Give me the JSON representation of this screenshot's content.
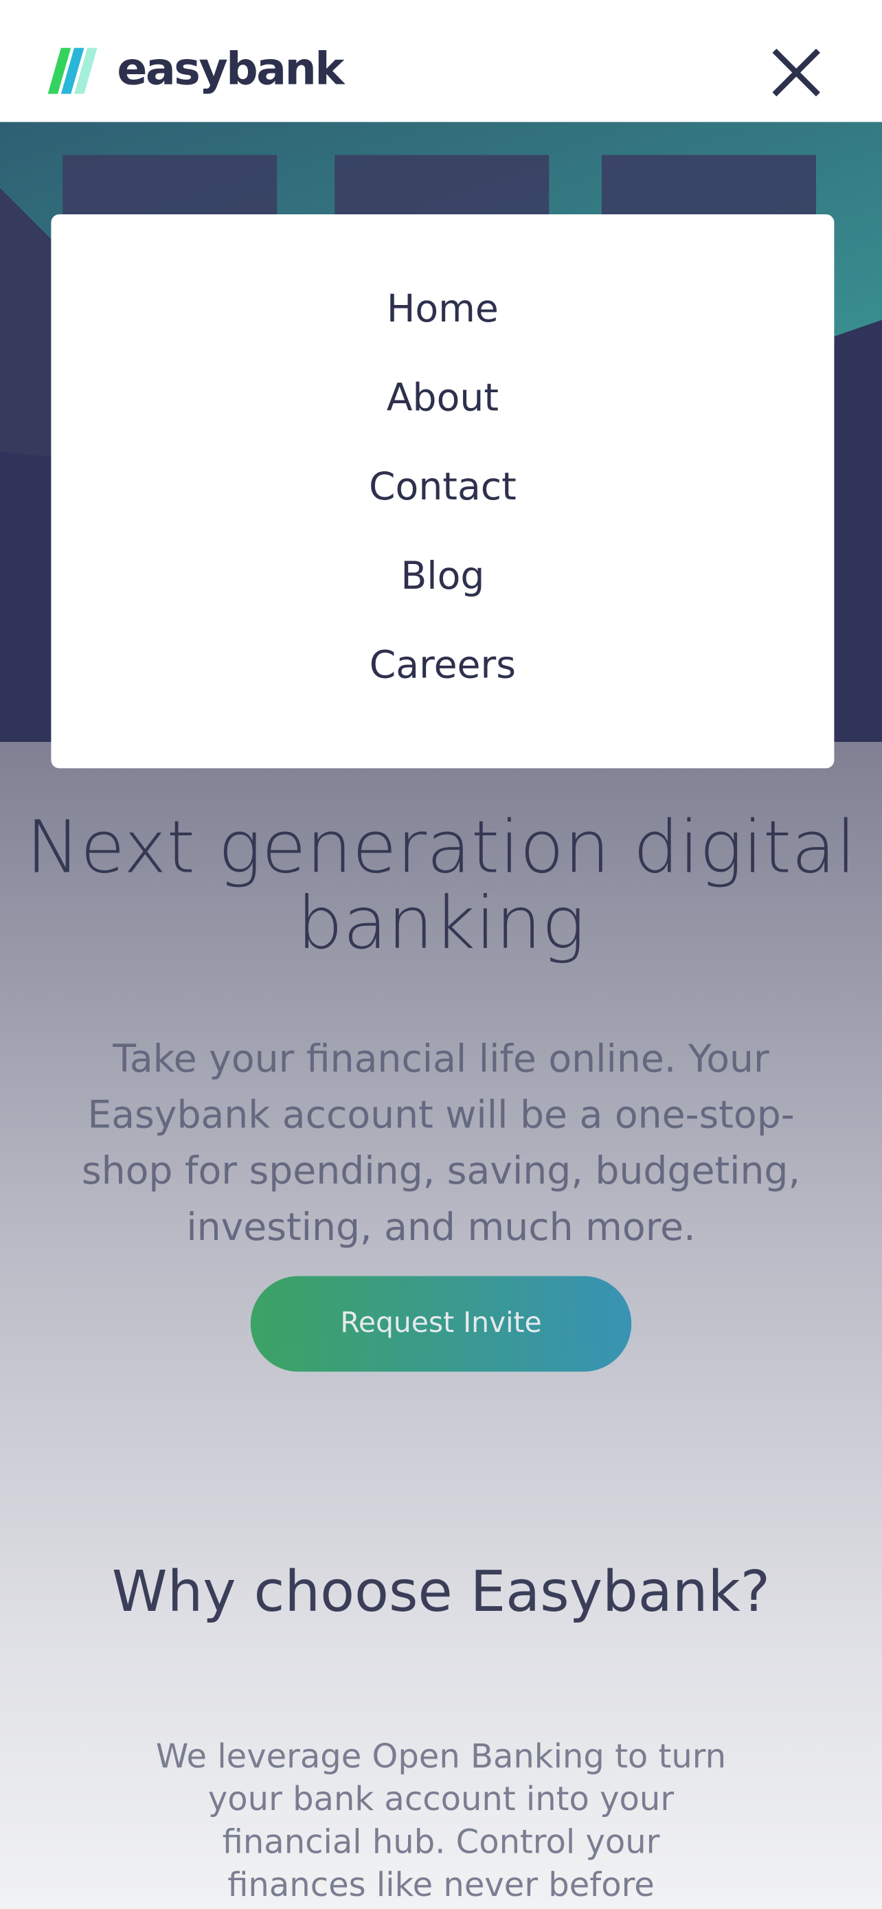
{
  "brand": {
    "name": "easybank",
    "logo_colors": [
      "#33d35e",
      "#2ab6d9"
    ],
    "text_color": "#2d314d"
  },
  "header": {
    "close_icon": "close-icon"
  },
  "menu": {
    "items": [
      {
        "label": "Home"
      },
      {
        "label": "About"
      },
      {
        "label": "Contact"
      },
      {
        "label": "Blog"
      },
      {
        "label": "Careers"
      }
    ]
  },
  "hero": {
    "title": "Next generation digital banking",
    "description": "Take your financial life online. Your Easybank account will be a one-stop-shop for spending, saving, budgeting, investing, and much more.",
    "cta_label": "Request Invite"
  },
  "why": {
    "title": "Why choose Easybank?",
    "description": "We leverage Open Banking to turn your bank account into your financial hub. Control your finances like never before"
  },
  "colors": {
    "dark_blue": "#2d314d",
    "lime_green": "#31d35c",
    "bright_cyan": "#2bb7da",
    "grayish_blue": "#9698a6"
  }
}
